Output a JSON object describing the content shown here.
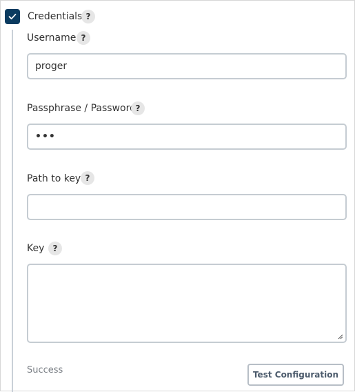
{
  "section": {
    "title": "Credentials",
    "checked": true,
    "help": "?"
  },
  "fields": {
    "username": {
      "label": "Username",
      "value": "proger",
      "help": "?"
    },
    "password": {
      "label": "Passphrase / Password",
      "masked_value": "•••",
      "help": "?"
    },
    "path_to_key": {
      "label": "Path to key",
      "value": "",
      "help": "?"
    },
    "key": {
      "label": "Key",
      "value": "",
      "help": "?"
    }
  },
  "status": "Success",
  "test_button": "Test Configuration",
  "colors": {
    "checkbox": "#0b3b60",
    "border": "#c5ccd2",
    "status": "#7a7f85"
  }
}
